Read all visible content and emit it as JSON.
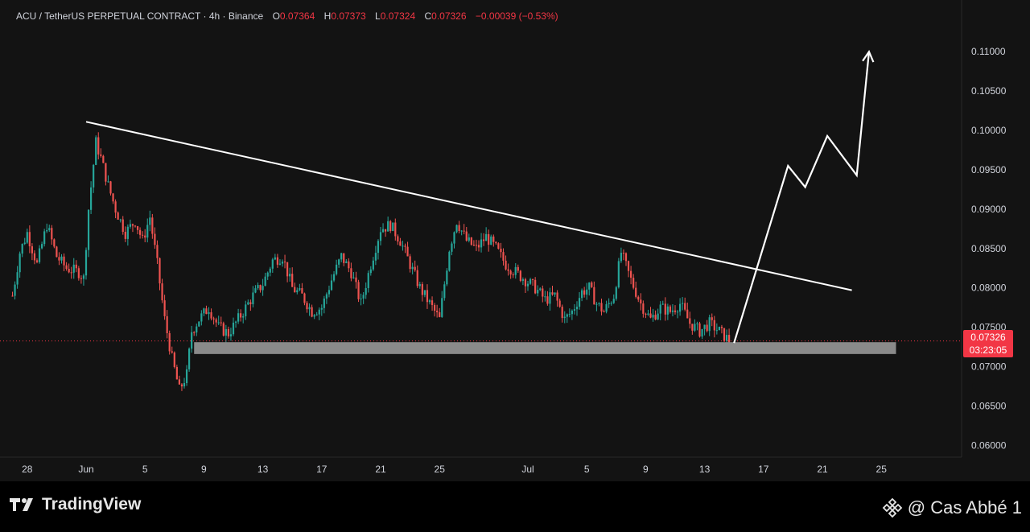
{
  "header": {
    "symbol": "ACU / TetherUS PERPETUAL CONTRACT · 4h · Binance",
    "o_key": "O",
    "o_val": "0.07364",
    "h_key": "H",
    "h_val": "0.07373",
    "l_key": "L",
    "l_val": "0.07324",
    "c_key": "C",
    "c_val": "0.07326",
    "change": "−0.00039 (−0.53%)"
  },
  "price_tag": {
    "price": "0.07326",
    "countdown": "03:23:05"
  },
  "footer": {
    "brand": "TradingView",
    "credit": "@ Cas Abbé 1"
  },
  "colors": {
    "background": "#131313",
    "up": "#26a69a",
    "down": "#ef5350",
    "annotation": "#ffffff",
    "support_zone": "#8a8a8a",
    "price_line": "#f23645"
  },
  "chart_data": {
    "type": "candlestick",
    "timeframe": "4h",
    "y_ticks": [
      "0.11000",
      "0.10500",
      "0.10000",
      "0.09500",
      "0.09000",
      "0.08500",
      "0.08000",
      "0.07500",
      "0.07000",
      "0.06500",
      "0.06000"
    ],
    "ylim": [
      0.0585,
      0.1135
    ],
    "x_ticks": [
      "28",
      "Jun",
      "5",
      "9",
      "13",
      "17",
      "21",
      "25",
      "Jul",
      "5",
      "9",
      "13",
      "17",
      "21",
      "25"
    ],
    "x_tick_dates": [
      "2024-05-28",
      "2024-06-01",
      "2024-06-05",
      "2024-06-09",
      "2024-06-13",
      "2024-06-17",
      "2024-06-21",
      "2024-06-25",
      "2024-07-01",
      "2024-07-05",
      "2024-07-09",
      "2024-07-13",
      "2024-07-17",
      "2024-07-21",
      "2024-07-25"
    ],
    "last_price": 0.07326,
    "price_path": [
      [
        "2024-05-27 00:00",
        0.079
      ],
      [
        "2024-05-27 12:00",
        0.0845
      ],
      [
        "2024-05-28 00:00",
        0.087
      ],
      [
        "2024-05-28 16:00",
        0.083
      ],
      [
        "2024-05-29 08:00",
        0.088
      ],
      [
        "2024-05-30 00:00",
        0.084
      ],
      [
        "2024-05-30 16:00",
        0.0825
      ],
      [
        "2024-05-31 12:00",
        0.082
      ],
      [
        "2024-05-31 20:00",
        0.0812
      ],
      [
        "2024-06-01 04:00",
        0.09
      ],
      [
        "2024-06-01 16:00",
        0.0985
      ],
      [
        "2024-06-02 00:00",
        0.0965
      ],
      [
        "2024-06-02 12:00",
        0.093
      ],
      [
        "2024-06-03 00:00",
        0.09
      ],
      [
        "2024-06-03 16:00",
        0.087
      ],
      [
        "2024-06-04 08:00",
        0.0885
      ],
      [
        "2024-06-04 20:00",
        0.086
      ],
      [
        "2024-06-05 08:00",
        0.089
      ],
      [
        "2024-06-05 20:00",
        0.083
      ],
      [
        "2024-06-06 08:00",
        0.076
      ],
      [
        "2024-06-06 20:00",
        0.071
      ],
      [
        "2024-06-07 08:00",
        0.067
      ],
      [
        "2024-06-07 20:00",
        0.069
      ],
      [
        "2024-06-08 04:00",
        0.0745
      ],
      [
        "2024-06-08 16:00",
        0.076
      ],
      [
        "2024-06-09 08:00",
        0.0775
      ],
      [
        "2024-06-10 00:00",
        0.075
      ],
      [
        "2024-06-10 16:00",
        0.0742
      ],
      [
        "2024-06-11 12:00",
        0.0765
      ],
      [
        "2024-06-12 08:00",
        0.079
      ],
      [
        "2024-06-13 00:00",
        0.0805
      ],
      [
        "2024-06-13 16:00",
        0.0835
      ],
      [
        "2024-06-14 08:00",
        0.084
      ],
      [
        "2024-06-15 00:00",
        0.08
      ],
      [
        "2024-06-15 16:00",
        0.079
      ],
      [
        "2024-06-16 08:00",
        0.077
      ],
      [
        "2024-06-17 00:00",
        0.0775
      ],
      [
        "2024-06-17 16:00",
        0.081
      ],
      [
        "2024-06-18 08:00",
        0.084
      ],
      [
        "2024-06-19 00:00",
        0.082
      ],
      [
        "2024-06-19 16:00",
        0.078
      ],
      [
        "2024-06-20 08:00",
        0.083
      ],
      [
        "2024-06-21 00:00",
        0.0875
      ],
      [
        "2024-06-21 16:00",
        0.088
      ],
      [
        "2024-06-22 08:00",
        0.086
      ],
      [
        "2024-06-23 00:00",
        0.083
      ],
      [
        "2024-06-23 16:00",
        0.08
      ],
      [
        "2024-06-24 08:00",
        0.078
      ],
      [
        "2024-06-25 00:00",
        0.076
      ],
      [
        "2024-06-25 16:00",
        0.085
      ],
      [
        "2024-06-26 04:00",
        0.0885
      ],
      [
        "2024-06-26 20:00",
        0.086
      ],
      [
        "2024-06-27 12:00",
        0.085
      ],
      [
        "2024-06-28 04:00",
        0.0865
      ],
      [
        "2024-06-28 20:00",
        0.085
      ],
      [
        "2024-06-29 12:00",
        0.083
      ],
      [
        "2024-06-30 04:00",
        0.082
      ],
      [
        "2024-06-30 20:00",
        0.081
      ],
      [
        "2024-07-01 12:00",
        0.08
      ],
      [
        "2024-07-02 04:00",
        0.0785
      ],
      [
        "2024-07-02 20:00",
        0.079
      ],
      [
        "2024-07-03 12:00",
        0.076
      ],
      [
        "2024-07-04 00:00",
        0.077
      ],
      [
        "2024-07-04 16:00",
        0.0795
      ],
      [
        "2024-07-05 04:00",
        0.08
      ],
      [
        "2024-07-05 16:00",
        0.078
      ],
      [
        "2024-07-06 04:00",
        0.077
      ],
      [
        "2024-07-06 20:00",
        0.079
      ],
      [
        "2024-07-07 08:00",
        0.0845
      ],
      [
        "2024-07-08 00:00",
        0.081
      ],
      [
        "2024-07-08 16:00",
        0.078
      ],
      [
        "2024-07-09 08:00",
        0.076
      ],
      [
        "2024-07-10 00:00",
        0.0775
      ],
      [
        "2024-07-10 16:00",
        0.077
      ],
      [
        "2024-07-11 08:00",
        0.078
      ],
      [
        "2024-07-12 00:00",
        0.0755
      ],
      [
        "2024-07-12 16:00",
        0.0745
      ],
      [
        "2024-07-13 08:00",
        0.0755
      ],
      [
        "2024-07-14 00:00",
        0.0745
      ],
      [
        "2024-07-14 16:00",
        0.0733
      ]
    ],
    "annotations": {
      "descending_trendline": {
        "start": [
          "2024-06-01 00:00",
          0.1011
        ],
        "end": [
          "2024-07-23 00:00",
          0.0797
        ]
      },
      "support_zone": {
        "from": "2024-06-08 08:00",
        "to": "2024-07-26 00:00",
        "top": 0.0731,
        "bottom": 0.0716
      },
      "projection_path": [
        [
          "2024-07-15 00:00",
          0.073
        ],
        [
          "2024-07-18 16:00",
          0.0955
        ],
        [
          "2024-07-19 20:00",
          0.0928
        ],
        [
          "2024-07-21 08:00",
          0.0993
        ],
        [
          "2024-07-23 08:00",
          0.0943
        ],
        [
          "2024-07-24 04:00",
          0.11
        ]
      ]
    }
  }
}
